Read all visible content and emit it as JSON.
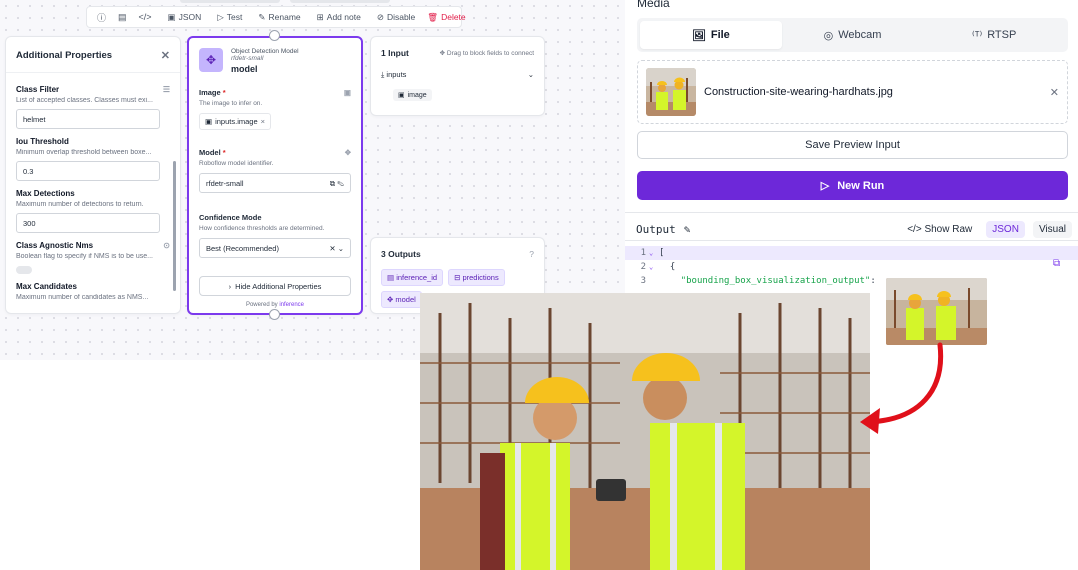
{
  "toolbar": {
    "json_label": "JSON",
    "test_label": "Test",
    "rename_label": "Rename",
    "add_note_label": "Add note",
    "disable_label": "Disable",
    "delete_label": "Delete"
  },
  "properties": {
    "title": "Additional Properties",
    "items": [
      {
        "label": "Class Filter",
        "desc": "List of accepted classes. Classes must exi...",
        "value": "helmet"
      },
      {
        "label": "Iou Threshold",
        "desc": "Minimum overlap threshold between boxe...",
        "value": "0.3"
      },
      {
        "label": "Max Detections",
        "desc": "Maximum number of detections to return.",
        "value": "300"
      },
      {
        "label": "Class Agnostic Nms",
        "desc": "Boolean flag to specify if NMS is to be use..."
      },
      {
        "label": "Max Candidates",
        "desc": "Maximum number of candidates as NMS..."
      }
    ]
  },
  "model_block": {
    "type": "Object Detection Model",
    "subtitle": "rfdetr-small",
    "name": "model",
    "image_label": "Image",
    "image_desc": "The image to infer on.",
    "image_chip": "inputs.image",
    "model_label": "Model",
    "model_desc": "Roboflow model identifier.",
    "model_value": "rfdetr-small",
    "conf_label": "Confidence Mode",
    "conf_desc": "How confidence thresholds are determined.",
    "conf_value": "Best (Recommended)",
    "hide_label": "Hide Additional Properties",
    "powered_prefix": "Powered by",
    "powered_brand": "inference"
  },
  "inputs_block": {
    "title": "1 Input",
    "hint": "Drag to block fields to connect",
    "row_label": "inputs",
    "chip": "image"
  },
  "outputs_block": {
    "title": "3 Outputs",
    "chips": [
      "inference_id",
      "predictions",
      "model"
    ]
  },
  "media": {
    "title": "Media",
    "tabs": [
      "File",
      "Webcam",
      "RTSP"
    ],
    "file_name": "Construction-site-wearing-hardhats.jpg",
    "save_label": "Save Preview Input",
    "run_label": "New Run"
  },
  "output": {
    "title": "Output",
    "show_raw": "Show Raw",
    "json": "JSON",
    "visual": "Visual",
    "lines": [
      {
        "n": "1",
        "text": "["
      },
      {
        "n": "2",
        "text": "  {"
      },
      {
        "n": "3",
        "key": "\"bounding_box_visualization_output\"",
        "text": ":"
      }
    ]
  },
  "colors": {
    "accent": "#6d28d9",
    "delete": "#e11d48",
    "annotation_arrow": "#e0101a"
  }
}
